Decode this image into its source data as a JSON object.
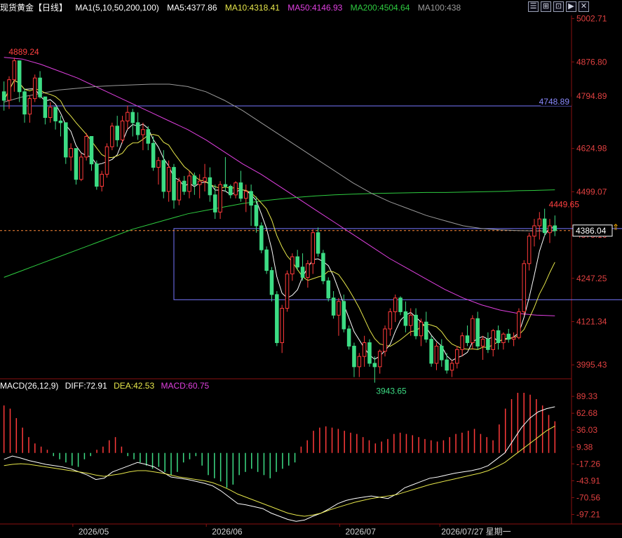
{
  "header": {
    "instrument": "现货黄金【日线】",
    "ma_label": "MA1(5,10,50,200,100)",
    "ma5": "MA5:4377.86",
    "ma10": "MA10:4318.41",
    "ma50": "MA50:4146.93",
    "ma200": "MA200:4504.64",
    "ma100": "MA100:438"
  },
  "macd_header": {
    "label": "MACD(26,12,9)",
    "diff": "DIFF:72.91",
    "dea": "DEA:42.53",
    "macd": "MACD:60.75"
  },
  "toolbar_glyphs": [
    "☰",
    "⊞",
    "⊡",
    "▶",
    "✕"
  ],
  "colors": {
    "up": "#ff3a3a",
    "down": "#3ddc84",
    "ma5": "#ffffff",
    "ma10": "#e6e64a",
    "ma50": "#e040e0",
    "ma200": "#2ecc40",
    "ma100": "#9a9a9a",
    "resistance": "#7777ff",
    "axis_text": "#e04040"
  },
  "chart_data": {
    "type": "candlestick",
    "dates_labels": [
      "2026/05",
      "2026/06",
      "2026/07",
      "2026/07/27 星期一"
    ],
    "price_axis_ticks": [
      "5002.71",
      "4876.80",
      "4750.89",
      "4624.98",
      "4499.07",
      "4373.16",
      "4247.25",
      "4121.34",
      "3995.43"
    ],
    "ylim": [
      3955,
      5012
    ],
    "annotations": {
      "high": "4889.24",
      "low": "3943.65",
      "recent_high": "4449.65",
      "resistance_label": "4748.89",
      "resistance_axis": "4794.89",
      "current_price": "4386.04"
    },
    "resistance_level": 4748.89,
    "current_level": 4386.04,
    "box": {
      "x_start_index": 33,
      "x_end_index": 125,
      "y_low": 4185,
      "y_high": 4392
    },
    "candles": [
      [
        4790,
        4820,
        4735,
        4765
      ],
      [
        4765,
        4835,
        4740,
        4825
      ],
      [
        4825,
        4889.24,
        4790,
        4880
      ],
      [
        4880,
        4850,
        4760,
        4790
      ],
      [
        4790,
        4800,
        4700,
        4725
      ],
      [
        4725,
        4780,
        4700,
        4770
      ],
      [
        4770,
        4840,
        4760,
        4830
      ],
      [
        4830,
        4850,
        4770,
        4775
      ],
      [
        4775,
        4770,
        4695,
        4715
      ],
      [
        4715,
        4760,
        4700,
        4745
      ],
      [
        4745,
        4735,
        4680,
        4705
      ],
      [
        4705,
        4720,
        4660,
        4700
      ],
      [
        4700,
        4690,
        4580,
        4600
      ],
      [
        4600,
        4640,
        4560,
        4625
      ],
      [
        4625,
        4620,
        4520,
        4535
      ],
      [
        4535,
        4610,
        4530,
        4600
      ],
      [
        4600,
        4670,
        4590,
        4660
      ],
      [
        4660,
        4650,
        4560,
        4580
      ],
      [
        4580,
        4590,
        4505,
        4515
      ],
      [
        4515,
        4560,
        4500,
        4550
      ],
      [
        4550,
        4640,
        4540,
        4630
      ],
      [
        4630,
        4700,
        4620,
        4690
      ],
      [
        4690,
        4720,
        4630,
        4650
      ],
      [
        4650,
        4720,
        4640,
        4705
      ],
      [
        4705,
        4750,
        4680,
        4730
      ],
      [
        4730,
        4740,
        4660,
        4700
      ],
      [
        4700,
        4730,
        4650,
        4665
      ],
      [
        4665,
        4700,
        4620,
        4680
      ],
      [
        4680,
        4690,
        4620,
        4640
      ],
      [
        4640,
        4660,
        4560,
        4570
      ],
      [
        4570,
        4600,
        4520,
        4590
      ],
      [
        4590,
        4620,
        4480,
        4500
      ],
      [
        4500,
        4590,
        4470,
        4570
      ],
      [
        4570,
        4580,
        4450,
        4475
      ],
      [
        4475,
        4540,
        4460,
        4530
      ],
      [
        4530,
        4545,
        4490,
        4500
      ],
      [
        4500,
        4560,
        4480,
        4545
      ],
      [
        4545,
        4555,
        4490,
        4520
      ],
      [
        4520,
        4550,
        4480,
        4530
      ],
      [
        4530,
        4580,
        4500,
        4540
      ],
      [
        4540,
        4570,
        4470,
        4490
      ],
      [
        4490,
        4520,
        4420,
        4440
      ],
      [
        4440,
        4530,
        4420,
        4520
      ],
      [
        4520,
        4600,
        4500,
        4515
      ],
      [
        4515,
        4520,
        4480,
        4490
      ],
      [
        4490,
        4530,
        4480,
        4525
      ],
      [
        4525,
        4560,
        4470,
        4480
      ],
      [
        4480,
        4520,
        4440,
        4500
      ],
      [
        4500,
        4520,
        4400,
        4460
      ],
      [
        4460,
        4485,
        4380,
        4400
      ],
      [
        4400,
        4410,
        4320,
        4330
      ],
      [
        4330,
        4340,
        4260,
        4270
      ],
      [
        4270,
        4280,
        4180,
        4200
      ],
      [
        4200,
        4210,
        4050,
        4060
      ],
      [
        4060,
        4170,
        4030,
        4160
      ],
      [
        4160,
        4270,
        4150,
        4260
      ],
      [
        4260,
        4320,
        4240,
        4310
      ],
      [
        4310,
        4330,
        4270,
        4280
      ],
      [
        4280,
        4320,
        4240,
        4250
      ],
      [
        4250,
        4300,
        4220,
        4290
      ],
      [
        4290,
        4390,
        4260,
        4380
      ],
      [
        4380,
        4395,
        4310,
        4320
      ],
      [
        4320,
        4330,
        4230,
        4240
      ],
      [
        4240,
        4250,
        4180,
        4190
      ],
      [
        4190,
        4210,
        4130,
        4140
      ],
      [
        4140,
        4190,
        4080,
        4180
      ],
      [
        4180,
        4200,
        4090,
        4100
      ],
      [
        4100,
        4110,
        4040,
        4050
      ],
      [
        4050,
        4060,
        3960,
        3990
      ],
      [
        3990,
        4030,
        3960,
        4020
      ],
      [
        4020,
        4080,
        3990,
        4060
      ],
      [
        4060,
        4070,
        3990,
        4000
      ],
      [
        4000,
        4020,
        3943.65,
        3990
      ],
      [
        3990,
        4040,
        3970,
        4035
      ],
      [
        4035,
        4110,
        4020,
        4100
      ],
      [
        4100,
        4160,
        4080,
        4150
      ],
      [
        4150,
        4200,
        4120,
        4190
      ],
      [
        4190,
        4195,
        4140,
        4150
      ],
      [
        4150,
        4180,
        4090,
        4110
      ],
      [
        4110,
        4160,
        4080,
        4140
      ],
      [
        4140,
        4160,
        4070,
        4080
      ],
      [
        4080,
        4130,
        4050,
        4120
      ],
      [
        4120,
        4150,
        4060,
        4070
      ],
      [
        4070,
        4080,
        3990,
        4000
      ],
      [
        4000,
        4060,
        3980,
        4050
      ],
      [
        4050,
        4070,
        3990,
        4010
      ],
      [
        4010,
        4030,
        3970,
        3980
      ],
      [
        3980,
        4010,
        3960,
        4000
      ],
      [
        4000,
        4050,
        3985,
        4040
      ],
      [
        4040,
        4090,
        4020,
        4080
      ],
      [
        4080,
        4110,
        4050,
        4060
      ],
      [
        4060,
        4140,
        4040,
        4130
      ],
      [
        4130,
        4150,
        4040,
        4050
      ],
      [
        4050,
        4080,
        4010,
        4070
      ],
      [
        4070,
        4090,
        4030,
        4040
      ],
      [
        4040,
        4100,
        4020,
        4095
      ],
      [
        4095,
        4110,
        4040,
        4060
      ],
      [
        4060,
        4090,
        4040,
        4085
      ],
      [
        4085,
        4100,
        4060,
        4070
      ],
      [
        4070,
        4090,
        4050,
        4075
      ],
      [
        4075,
        4160,
        4070,
        4150
      ],
      [
        4150,
        4300,
        4140,
        4290
      ],
      [
        4290,
        4380,
        4270,
        4370
      ],
      [
        4370,
        4420,
        4340,
        4400
      ],
      [
        4400,
        4440,
        4360,
        4420
      ],
      [
        4420,
        4449.65,
        4370,
        4380
      ],
      [
        4380,
        4420,
        4350,
        4400
      ],
      [
        4400,
        4430,
        4370,
        4386.04
      ]
    ],
    "ma_series": [
      {
        "name": "MA50",
        "start": 0,
        "points": [
          4890,
          4885,
          4870,
          4850,
          4830,
          4805,
          4780,
          4755,
          4730,
          4705,
          4680,
          4650,
          4615,
          4580,
          4550,
          4515,
          4480,
          4445,
          4410,
          4375,
          4340,
          4305,
          4275,
          4245,
          4215,
          4190,
          4170,
          4155,
          4145,
          4140,
          4138
        ]
      },
      {
        "name": "MA200",
        "start": 0,
        "points": [
          4250,
          4270,
          4290,
          4310,
          4330,
          4350,
          4370,
          4390,
          4405,
          4420,
          4435,
          4445,
          4455,
          4465,
          4472,
          4478,
          4483,
          4487,
          4490,
          4492,
          4494,
          4495,
          4496,
          4497,
          4497,
          4498,
          4499,
          4500,
          4502,
          4503,
          4504.64
        ]
      },
      {
        "name": "MA100",
        "start": 0,
        "points": [
          4760,
          4775,
          4785,
          4795,
          4800,
          4805,
          4808,
          4810,
          4812,
          4812,
          4805,
          4790,
          4765,
          4735,
          4700,
          4665,
          4630,
          4595,
          4560,
          4525,
          4495,
          4470,
          4450,
          4430,
          4415,
          4400,
          4392,
          4388,
          4386,
          4385,
          4385
        ]
      }
    ],
    "macd": {
      "ylim": [
        -110,
        95
      ],
      "ticks": [
        "89.33",
        "62.68",
        "36.03",
        "9.38",
        "-17.26",
        "-43.91",
        "-70.56",
        "-97.21"
      ],
      "hist": [
        75,
        70,
        55,
        40,
        25,
        15,
        10,
        5,
        -5,
        -10,
        -15,
        -20,
        -22,
        -10,
        -5,
        5,
        10,
        20,
        25,
        10,
        -5,
        -10,
        -15,
        -20,
        -25,
        -22,
        -30,
        -35,
        -30,
        -15,
        -10,
        -5,
        -20,
        -35,
        -40,
        -45,
        -55,
        -50,
        -35,
        -30,
        -25,
        -30,
        -35,
        -40,
        -30,
        -25,
        -20,
        -15,
        10,
        20,
        35,
        40,
        42,
        40,
        38,
        35,
        32,
        30,
        25,
        20,
        15,
        18,
        22,
        30,
        32,
        30,
        28,
        25,
        22,
        20,
        18,
        20,
        25,
        30,
        32,
        35,
        38,
        30,
        25,
        20,
        45,
        70,
        85,
        95,
        95,
        92,
        85,
        75,
        60,
        50
      ],
      "diff": [
        -10,
        -5,
        -8,
        -12,
        -15,
        -18,
        -20,
        -22,
        -25,
        -30,
        -35,
        -42,
        -40,
        -30,
        -25,
        -20,
        -15,
        -18,
        -22,
        -30,
        -38,
        -40,
        -42,
        -45,
        -48,
        -52,
        -60,
        -70,
        -80,
        -82,
        -85,
        -88,
        -95,
        -100,
        -105,
        -108,
        -106,
        -100,
        -95,
        -88,
        -80,
        -75,
        -72,
        -70,
        -68,
        -70,
        -72,
        -65,
        -55,
        -50,
        -45,
        -40,
        -38,
        -35,
        -32,
        -30,
        -28,
        -25,
        -20,
        -10,
        0,
        20,
        40,
        55,
        65,
        70,
        72.91
      ],
      "dea": [
        -20,
        -18,
        -17,
        -18,
        -20,
        -22,
        -24,
        -26,
        -28,
        -30,
        -32,
        -35,
        -37,
        -35,
        -33,
        -30,
        -28,
        -28,
        -30,
        -32,
        -35,
        -38,
        -40,
        -42,
        -44,
        -47,
        -52,
        -58,
        -65,
        -70,
        -75,
        -80,
        -85,
        -90,
        -95,
        -98,
        -100,
        -98,
        -95,
        -90,
        -86,
        -82,
        -78,
        -75,
        -72,
        -70,
        -68,
        -66,
        -62,
        -58,
        -54,
        -50,
        -47,
        -44,
        -41,
        -38,
        -35,
        -32,
        -28,
        -22,
        -15,
        -5,
        5,
        15,
        25,
        35,
        42.53
      ]
    }
  }
}
